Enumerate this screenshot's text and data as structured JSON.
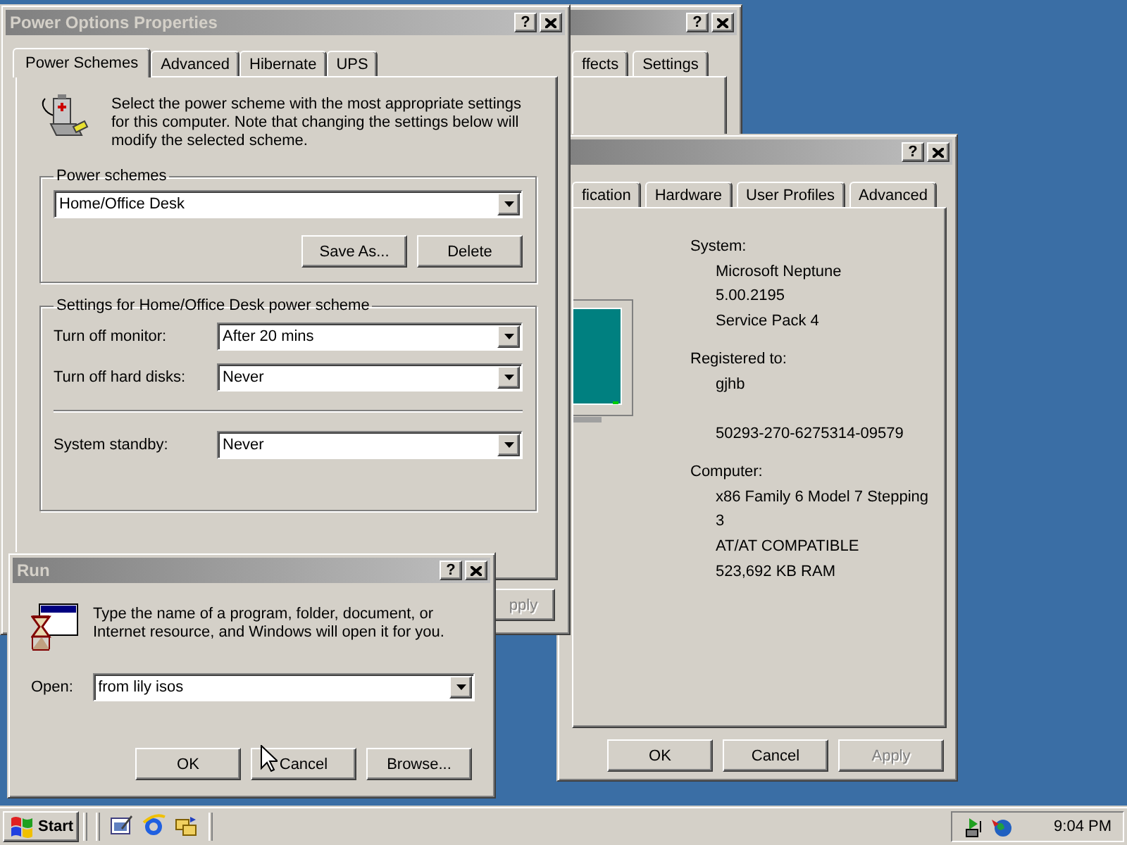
{
  "display_window": {
    "help_button": "?",
    "tabs": [
      {
        "label": "ffects",
        "selected": false
      },
      {
        "label": "Settings",
        "selected": false
      }
    ]
  },
  "system_window": {
    "help_button": "?",
    "tabs": [
      {
        "label": "fication",
        "selected": false
      },
      {
        "label": "Hardware",
        "selected": false
      },
      {
        "label": "User Profiles",
        "selected": false
      },
      {
        "label": "Advanced",
        "selected": false
      }
    ],
    "sections": [
      {
        "label": "System:",
        "lines": [
          "Microsoft Neptune",
          "5.00.2195",
          "Service Pack 4"
        ]
      },
      {
        "label": "Registered to:",
        "lines": [
          "gjhb"
        ],
        "product_id": "50293-270-6275314-09579"
      },
      {
        "label": "Computer:",
        "lines": [
          "x86 Family 6 Model 7 Stepping",
          "3",
          "AT/AT COMPATIBLE",
          "523,692 KB RAM"
        ]
      }
    ],
    "buttons": [
      {
        "label": "OK",
        "disabled": false
      },
      {
        "label": "Cancel",
        "disabled": false
      },
      {
        "label": "Apply",
        "disabled": true
      }
    ]
  },
  "power_window": {
    "title": "Power Options Properties",
    "help_button": "?",
    "tabs": [
      {
        "label": "Power Schemes",
        "selected": true
      },
      {
        "label": "Advanced",
        "selected": false
      },
      {
        "label": "Hibernate",
        "selected": false
      },
      {
        "label": "UPS",
        "selected": false
      }
    ],
    "intro": "Select the power scheme with the most appropriate settings for this computer. Note that changing the settings below will modify the selected scheme.",
    "schemes_group": {
      "label": "Power schemes",
      "value": "Home/Office Desk",
      "buttons": [
        {
          "label": "Save As...",
          "disabled": false
        },
        {
          "label": "Delete",
          "disabled": false
        }
      ]
    },
    "settings_group": {
      "label": "Settings for Home/Office Desk power scheme",
      "rows": [
        {
          "label": "Turn off monitor:",
          "value": "After 20 mins",
          "separated": false
        },
        {
          "label": "Turn off hard disks:",
          "value": "Never",
          "separated": false
        },
        {
          "label": "System standby:",
          "value": "Never",
          "separated": true
        }
      ]
    },
    "buttons": [
      {
        "label": "pply",
        "disabled": true
      }
    ]
  },
  "run_dialog": {
    "title": "Run",
    "help_button": "?",
    "prompt": "Type the name of a program, folder, document, or Internet resource, and Windows will open it for you.",
    "open_label": "Open:",
    "open_value": "from lily isos",
    "buttons": [
      {
        "label": "OK",
        "disabled": false
      },
      {
        "label": "Cancel",
        "disabled": false
      },
      {
        "label": "Browse...",
        "disabled": false
      }
    ]
  },
  "taskbar": {
    "start": "Start",
    "clock": "9:04 PM"
  }
}
